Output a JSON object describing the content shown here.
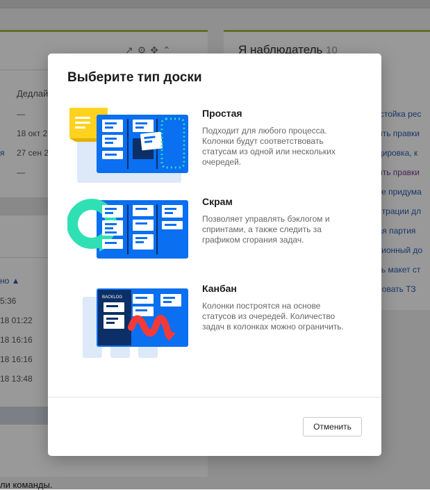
{
  "background": {
    "watcher_title": "Я наблюдатель",
    "watcher_count": "10",
    "deadline_label": "Дедлай",
    "dash1": "—",
    "date1": "18 окт 2",
    "link_left": "я",
    "date2": "27 сен 2",
    "dash2": "—",
    "sort_label": "но ▲",
    "times": [
      "5:36",
      "18 01:22",
      "18 16:16",
      "18 16:16",
      "18 13:48"
    ],
    "links": [
      "я стойка рес",
      "дить правки",
      "ндировка, к",
      "дить правки",
      "йте придума",
      "острации дл",
      "ная партия",
      "нзионный до",
      "ать макет ст",
      "асовать ТЗ"
    ],
    "bottom_text": "ли команды."
  },
  "modal": {
    "title": "Выберите тип доски",
    "options": [
      {
        "title": "Простая",
        "description": "Подходит для любого процесса. Колонки будут соответствовать статусам из одной или нескольких очередей."
      },
      {
        "title": "Скрам",
        "description": "Позволяет управлять бэклогом и спринтами, а также следить за графиком сгорания задач."
      },
      {
        "title": "Канбан",
        "description": "Колонки построятся на основе статусов из очередей. Количество задач в колонках можно ограничить.",
        "illustration_label": "BACKLOG"
      }
    ],
    "cancel_label": "Отменить"
  },
  "colors": {
    "board_blue": "#0a6ff0",
    "sticky_yellow": "#ffd21f",
    "scrum_teal": "#2fe0b5",
    "kanban_red": "#f23a3a",
    "accent_green": "#a6b446"
  }
}
